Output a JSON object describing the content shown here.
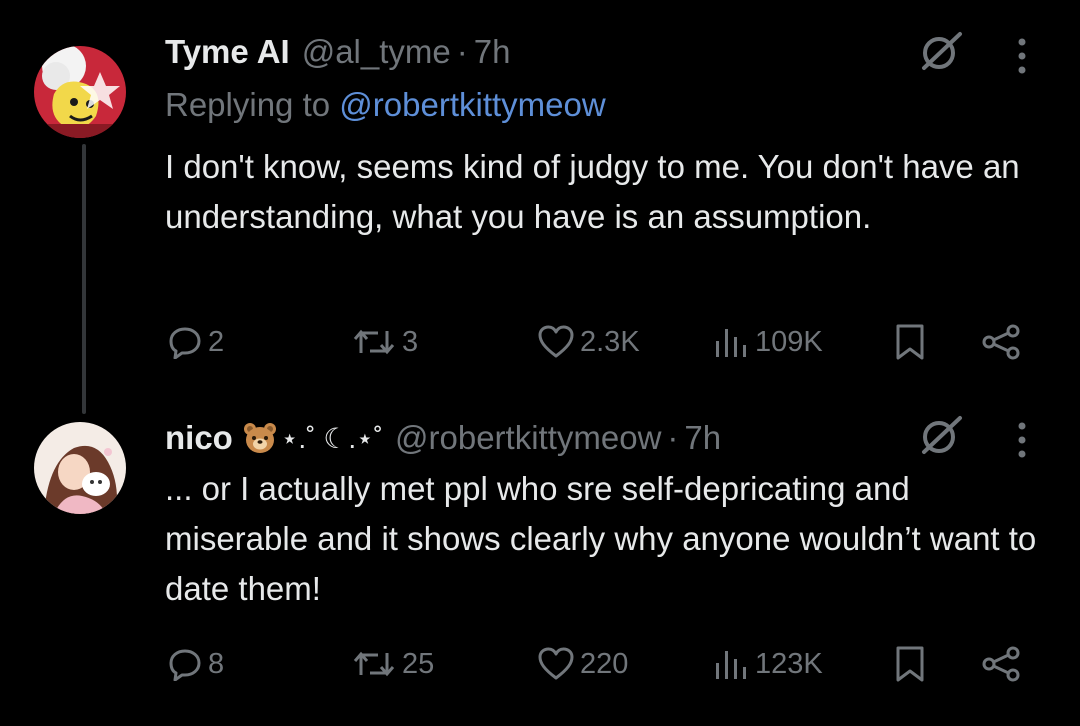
{
  "tweets": [
    {
      "display_name": "Tyme AI",
      "handle": "@al_tyme",
      "separator": "·",
      "time": "7h",
      "replying_prefix": "Replying to",
      "replying_to": "@robertkittymeow",
      "text": "I don't know, seems kind of judgy to me. You don't have an understanding, what you have is an assumption.",
      "replies": "2",
      "reposts": "3",
      "likes": "2.3K",
      "views": "109K"
    },
    {
      "display_name": "nico",
      "name_decoration": "⋆.˚ ☾.⋆˚",
      "handle": "@robertkittymeow",
      "separator": "·",
      "time": "7h",
      "text": "... or I actually met ppl who sre self-depricating and miserable and it shows clearly why anyone wouldn’t want to date them!",
      "replies": "8",
      "reposts": "25",
      "likes": "220",
      "views": "123K"
    }
  ],
  "colors": {
    "background": "#000000",
    "primary_text": "#e7e9ea",
    "secondary_text": "#71767b",
    "link": "#5e8fd8",
    "thread_line": "#333639"
  },
  "icons": {
    "grok": "grok-slash-icon",
    "more": "more-vertical-icon",
    "reply": "reply-bubble-icon",
    "repost": "repost-arrows-icon",
    "like": "heart-icon",
    "views": "bar-chart-icon",
    "bookmark": "bookmark-icon",
    "share": "share-icon"
  }
}
